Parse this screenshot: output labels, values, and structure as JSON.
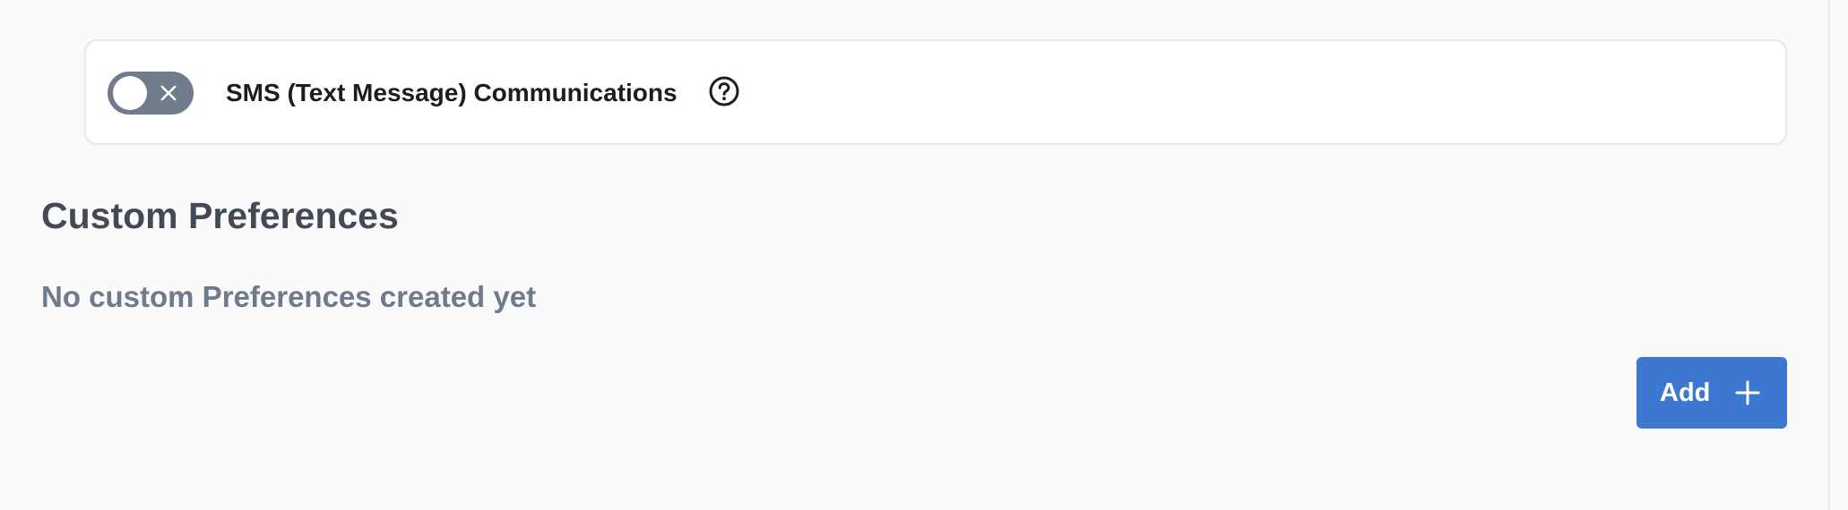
{
  "preferences": {
    "sms": {
      "label": "SMS (Text Message) Communications",
      "enabled": false,
      "toggle_icon": "close-icon",
      "help_icon": "question-circle-icon"
    }
  },
  "custom_preferences": {
    "title": "Custom Preferences",
    "empty_message": "No custom Preferences created yet",
    "add_button_label": "Add",
    "add_button_icon": "plus-icon"
  },
  "colors": {
    "accent": "#3d78d0",
    "toggle_off": "#707b8c",
    "title_text": "#434a57",
    "muted_text": "#6f7b8c",
    "background": "#fafafa"
  }
}
